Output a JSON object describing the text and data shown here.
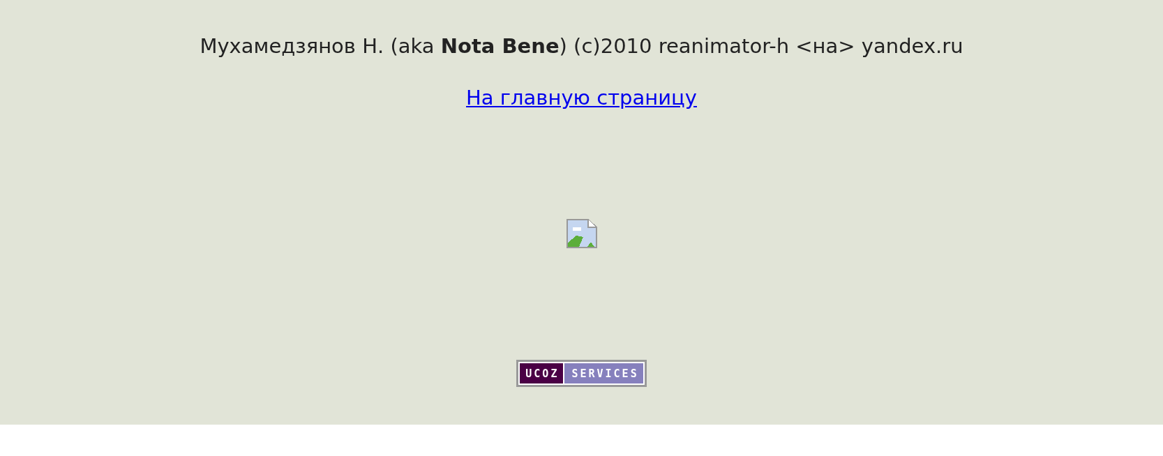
{
  "credits": "Мухамедзянов Н. (aka **Nota Bene**) (c)2010 reanimator-h <на> yandex.ru",
  "home_link": "На главную страницу",
  "badge": {
    "left": "UCOZ",
    "right": "SERVICES"
  }
}
